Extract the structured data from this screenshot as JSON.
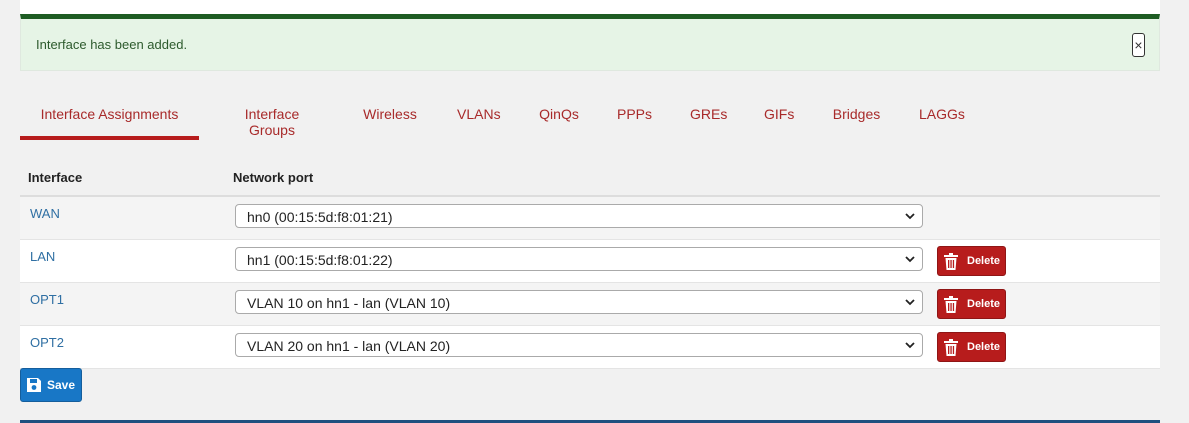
{
  "alert": {
    "message": "Interface has been added.",
    "close_symbol": "×",
    "bg_color": "#e6f4e6",
    "border_color": "#1e5c23"
  },
  "tabs": [
    {
      "label": "Interface Assignments",
      "active": true
    },
    {
      "label": "Interface Groups",
      "active": false
    },
    {
      "label": "Wireless",
      "active": false
    },
    {
      "label": "VLANs",
      "active": false
    },
    {
      "label": "QinQs",
      "active": false
    },
    {
      "label": "PPPs",
      "active": false
    },
    {
      "label": "GREs",
      "active": false
    },
    {
      "label": "GIFs",
      "active": false
    },
    {
      "label": "Bridges",
      "active": false
    },
    {
      "label": "LAGGs",
      "active": false
    }
  ],
  "table": {
    "headers": {
      "interface": "Interface",
      "network_port": "Network port"
    },
    "rows": [
      {
        "interface": "WAN",
        "port": "hn0 (00:15:5d:f8:01:21)",
        "deletable": false
      },
      {
        "interface": "LAN",
        "port": "hn1 (00:15:5d:f8:01:22)",
        "deletable": true
      },
      {
        "interface": "OPT1",
        "port": "VLAN 10 on hn1 - lan (VLAN 10)",
        "deletable": true
      },
      {
        "interface": "OPT2",
        "port": "VLAN 20 on hn1 - lan (VLAN 20)",
        "deletable": true
      }
    ]
  },
  "buttons": {
    "delete_label": "Delete",
    "save_label": "Save",
    "delete_color": "#b71c1c",
    "save_color": "#1877c6"
  },
  "icons": {
    "delete": "trash-icon",
    "save": "floppy-disk-icon",
    "dropdown": "chevron-down-icon",
    "close": "close-icon"
  }
}
